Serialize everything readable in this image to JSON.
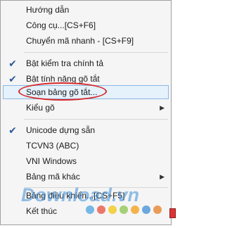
{
  "menu": {
    "items": [
      {
        "label": "Hướng dẫn"
      },
      {
        "label": "Công cụ...[CS+F6]"
      },
      {
        "label": "Chuyển mã nhanh - [CS+F9]"
      },
      {
        "label": "Bật kiểm tra chính tả",
        "checked": true
      },
      {
        "label": "Bật tính năng gõ tắt",
        "checked": true
      },
      {
        "label": "Soạn bảng gõ tắt...",
        "highlighted": true,
        "annotated": true
      },
      {
        "label": "Kiểu gõ",
        "submenu": true
      },
      {
        "label": "Unicode dựng sẵn",
        "checked": true
      },
      {
        "label": "TCVN3 (ABC)"
      },
      {
        "label": "VNI Windows"
      },
      {
        "label": "Bảng mã khác",
        "submenu": true
      },
      {
        "label": "Bảng điều khiển...[CS+F5]"
      },
      {
        "label": "Kết thúc"
      }
    ],
    "check_glyph": "✔",
    "arrow_glyph": "▶"
  },
  "watermark": {
    "text": "Download.vn",
    "dot_colors": [
      "#4aa3df",
      "#e74c3c",
      "#f1c40f",
      "#8bc34a",
      "#f39c12",
      "#3b8ed6",
      "#e67e22"
    ]
  },
  "colors": {
    "highlight_bg": "#e5f1fb",
    "highlight_border": "#89b8e3",
    "annotation": "#d62828",
    "check": "#2d5a9c"
  }
}
